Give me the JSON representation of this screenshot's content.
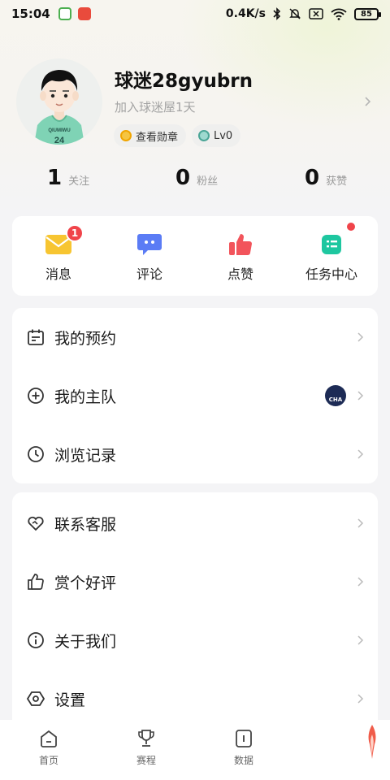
{
  "status_bar": {
    "time": "15:04",
    "network_speed": "0.4K/s",
    "battery": "85"
  },
  "profile": {
    "username": "球迷28gyubrn",
    "joined_text": "加入球迷屋1天",
    "jersey_text": "QIUMIWU",
    "jersey_number": "24",
    "medal_chip": "查看勋章",
    "level_chip": "Lv0"
  },
  "stats": [
    {
      "value": "1",
      "label": "关注"
    },
    {
      "value": "0",
      "label": "粉丝"
    },
    {
      "value": "0",
      "label": "获赞"
    }
  ],
  "actions": [
    {
      "label": "消息",
      "icon": "envelope-icon",
      "badge": "1"
    },
    {
      "label": "评论",
      "icon": "chat-bubble-icon"
    },
    {
      "label": "点赞",
      "icon": "thumbs-up-icon"
    },
    {
      "label": "任务中心",
      "icon": "task-list-icon",
      "dot": true
    }
  ],
  "menu_group_1": [
    {
      "label": "我的预约",
      "icon": "calendar-icon"
    },
    {
      "label": "我的主队",
      "icon": "plus-circle-icon",
      "team_logo_text": "CHA"
    },
    {
      "label": "浏览记录",
      "icon": "clock-icon"
    }
  ],
  "menu_group_2": [
    {
      "label": "联系客服",
      "icon": "heart-handshake-icon"
    },
    {
      "label": "赏个好评",
      "icon": "thumbs-up-outline-icon"
    },
    {
      "label": "关于我们",
      "icon": "info-icon"
    },
    {
      "label": "设置",
      "icon": "hexagon-settings-icon"
    }
  ],
  "bottom_nav": [
    {
      "label": "首页",
      "icon": "home-icon"
    },
    {
      "label": "赛程",
      "icon": "trophy-icon"
    },
    {
      "label": "数据",
      "icon": "data-icon"
    }
  ],
  "colors": {
    "badge_red": "#f0444a",
    "envelope_yellow": "#f7c531",
    "comment_blue": "#5b7cf5",
    "like_red": "#f2545b",
    "task_green": "#1ec7a0"
  }
}
